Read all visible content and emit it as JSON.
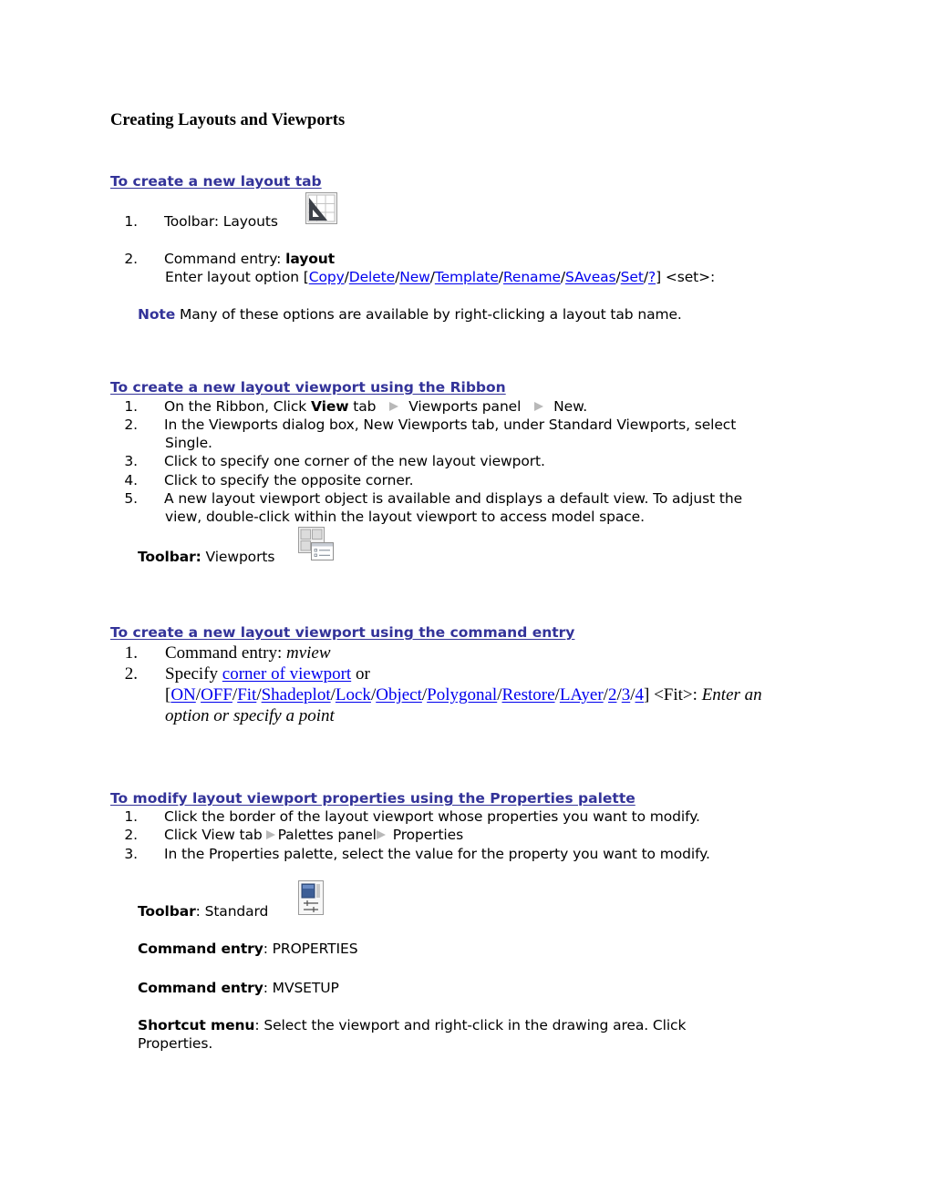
{
  "document": {
    "title": "Creating Layouts and Viewports",
    "colors": {
      "heading": "#333399",
      "link": "#0000ee",
      "note": "#333399",
      "arrow": "#b8b8b8"
    }
  },
  "section1": {
    "heading": "To create a new layout tab",
    "step1": {
      "num": "1.",
      "text": "Toolbar: Layouts",
      "icon": "layouts-toolbar-icon"
    },
    "step2": {
      "num": "2.",
      "label": "Command entry: ",
      "command": "layout",
      "prompt_prefix": "Enter layout option [",
      "options": [
        "Copy",
        "Delete",
        "New",
        "Template",
        "Rename",
        "SAveas",
        "Set",
        "?"
      ],
      "separator": "/",
      "prompt_suffix": "] <set>:"
    },
    "note": {
      "label": "Note",
      "text": " Many of these options are available by right-clicking a layout tab name."
    }
  },
  "section2": {
    "heading": "To create a new layout viewport using the Ribbon",
    "steps": [
      {
        "num": "1.",
        "parts": {
          "a": "On the Ribbon, Click ",
          "bold": "View",
          "b": " tab",
          "c": "Viewports panel",
          "d": "New."
        }
      },
      {
        "num": "2.",
        "line1": "In the Viewports dialog box, New Viewports tab, under Standard Viewports, select",
        "line2": "Single."
      },
      {
        "num": "3.",
        "text": "Click to specify one corner of the new layout viewport."
      },
      {
        "num": "4.",
        "text": "Click to specify the opposite corner."
      },
      {
        "num": "5.",
        "line1": "A new layout viewport object is available and displays a default view. To adjust the",
        "line2": "view, double-click within the layout viewport to access model space."
      }
    ],
    "toolbar": {
      "label": "Toolbar:",
      "text": " Viewports",
      "icon": "viewports-toolbar-icon"
    }
  },
  "section3": {
    "heading": "To create a new layout viewport using the command entry",
    "step1": {
      "num": "1.",
      "text": "Command entry: ",
      "command": "mview"
    },
    "step2": {
      "num": "2.",
      "text": "Specify ",
      "link": "corner of viewport",
      "after": " or",
      "open_bracket": "[",
      "options": [
        "ON",
        "OFF",
        "Fit",
        "Shadeplot",
        "Lock",
        "Object",
        "Polygonal",
        "Restore",
        "LAyer",
        "2",
        "3",
        "4"
      ],
      "separator": "/",
      "close": "] <Fit>: ",
      "italic1": "Enter an",
      "italic2": "option or specify a point"
    }
  },
  "section4": {
    "heading": "To modify layout viewport properties using the Properties palette ",
    "steps": [
      {
        "num": "1.",
        "text": "Click the border of the layout viewport whose properties you want to modify."
      },
      {
        "num": "2.",
        "a": "Click View tab",
        "b": "Palettes panel",
        "c": " Properties"
      },
      {
        "num": "3.",
        "text": "In the Properties palette, select the value for the property you want to modify."
      }
    ],
    "toolbar": {
      "label": "Toolbar",
      "text": ": Standard",
      "icon": "properties-toolbar-icon"
    },
    "command1": {
      "label": "Command entry",
      "text": ": PROPERTIES"
    },
    "command2": {
      "label": "Command entry",
      "text": ": MVSETUP"
    },
    "shortcut": {
      "label": "Shortcut menu",
      "line1": ": Select the viewport and right-click in the drawing area. Click",
      "line2": "Properties."
    }
  }
}
